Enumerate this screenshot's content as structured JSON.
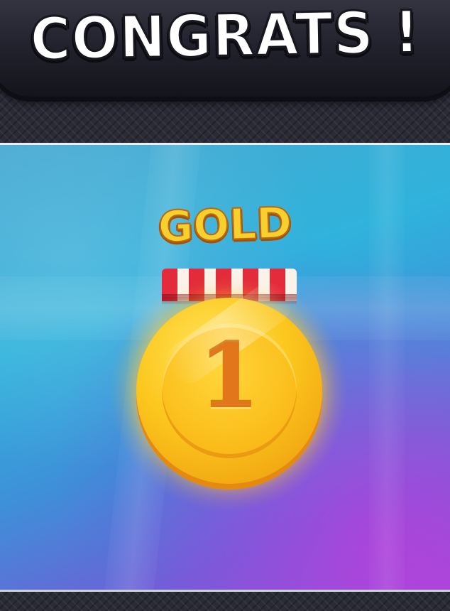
{
  "header": {
    "title": "CONGRATS !"
  },
  "award": {
    "rank_label": "GOLD",
    "medal_number": "1"
  },
  "colors": {
    "gold_text": "#f7cf2e",
    "medal_gold": "#fcc71e",
    "ribbon_red": "#e32b3c",
    "ribbon_white": "#fbf2ea",
    "banner_dark": "#22222e"
  }
}
